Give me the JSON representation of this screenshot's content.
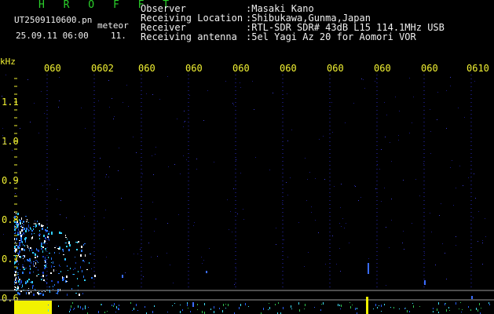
{
  "header": {
    "app_title": "H R O F F T",
    "file_name": "UT2509110600.pn",
    "file_suffix": "meteor",
    "datetime": "25.09.11 06:00",
    "freq_small": "11."
  },
  "station_info": [
    {
      "label": "Observer",
      "value": ":Masaki Kano"
    },
    {
      "label": "Receiving Location",
      "value": ":Shibukawa,Gunma,Japan"
    },
    {
      "label": "Receiver",
      "value": ":RTL-SDR SDR# 43dB L15 114.1MHz USB"
    },
    {
      "label": "Receiving antenna",
      "value": ":5el Yagi Az 20 for Aomori VOR"
    }
  ],
  "axis": {
    "y_unit": "kHz",
    "y_ticks": [
      "1.1",
      "1.0",
      "0.9",
      "0.8",
      "0.7",
      "0.6"
    ],
    "x_ticks": [
      "060",
      "0602",
      "060",
      "060",
      "060",
      "060",
      "060",
      "060",
      "060",
      "0610"
    ]
  },
  "colors": {
    "text_green": "#2bd12b",
    "text_yellow": "#f2f233",
    "text_white": "#f0f0f0",
    "background": "#000000",
    "grid_dots": "#2a2ac0"
  }
}
